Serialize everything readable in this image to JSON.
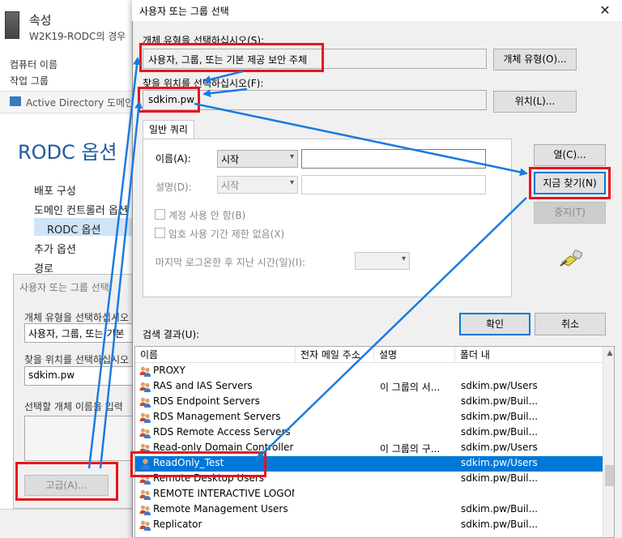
{
  "background_window": {
    "title": "속성",
    "subtitle": "W2K19-RODC의 경우",
    "computer_name_label": "컴퓨터 이름",
    "workgroup_label": "작업 그룹",
    "ad_bar_text": "Active Directory 도메인",
    "rodc_title": "RODC 옵션",
    "nav_items": [
      "배포 구성",
      "도메인 컨트롤러 옵션",
      "RODC 옵션",
      "추가 옵션",
      "경로"
    ],
    "inner_dialog": {
      "title": "사용자 또는 그룹 선택",
      "object_type_label": "개체 유형을 선택하십시오",
      "object_type_value": "사용자, 그룹, 또는 기본",
      "location_label": "찾을 위치를 선택하십시오",
      "location_value": "sdkim.pw",
      "enter_names_label": "선택할 개체 이름을 입력",
      "advanced_button": "고급(A)..."
    }
  },
  "dialog": {
    "title": "사용자 또는 그룹 선택",
    "object_type_label": "개체 유형을 선택하십시오(S):",
    "object_type_value": "사용자, 그룹, 또는 기본 제공 보안 주체",
    "object_types_button": "개체 유형(O)...",
    "location_label": "찾을 위치를 선택하십시오(F):",
    "location_value": "sdkim.pw",
    "locations_button": "위치(L)...",
    "tab_common_queries": "일반 쿼리",
    "name_label": "이름(A):",
    "name_combo_value": "시작",
    "description_label": "설명(D):",
    "description_combo_value": "시작",
    "disabled_accounts_label": "계정 사용 안 함(B)",
    "non_expiring_label": "암호 사용 기간 제한 없음(X)",
    "days_since_logon_label": "마지막 로그온한 후 지난 시간(일)(I):",
    "columns_button": "열(C)...",
    "find_now_button": "지금 찾기(N)",
    "stop_button": "중지(T)",
    "ok_button": "확인",
    "cancel_button": "취소",
    "results_label": "검색 결과(U):",
    "columns": [
      "이름",
      "전자 메일 주소",
      "설명",
      "폴더 내"
    ],
    "rows": [
      {
        "name": "PROXY",
        "email": "",
        "description": "",
        "folder": "",
        "icon": "group-icon"
      },
      {
        "name": "RAS and IAS Servers",
        "email": "",
        "description": "이 그룹의 서...",
        "folder": "sdkim.pw/Users",
        "icon": "group-icon"
      },
      {
        "name": "RDS Endpoint Servers",
        "email": "",
        "description": "",
        "folder": "sdkim.pw/Buil...",
        "icon": "group-icon"
      },
      {
        "name": "RDS Management Servers",
        "email": "",
        "description": "",
        "folder": "sdkim.pw/Buil...",
        "icon": "group-icon"
      },
      {
        "name": "RDS Remote Access Servers",
        "email": "",
        "description": "",
        "folder": "sdkim.pw/Buil...",
        "icon": "group-icon"
      },
      {
        "name": "Read-only Domain Controllers",
        "email": "",
        "description": "이 그룹의 구...",
        "folder": "sdkim.pw/Users",
        "icon": "group-icon"
      },
      {
        "name": "ReadOnly_Test",
        "email": "",
        "description": "",
        "folder": "sdkim.pw/Users",
        "icon": "user-icon",
        "selected": true
      },
      {
        "name": "Remote Desktop Users",
        "email": "",
        "description": "",
        "folder": "sdkim.pw/Buil...",
        "icon": "group-icon"
      },
      {
        "name": "REMOTE INTERACTIVE LOGON",
        "email": "",
        "description": "",
        "folder": "",
        "icon": "group-icon"
      },
      {
        "name": "Remote Management Users",
        "email": "",
        "description": "",
        "folder": "sdkim.pw/Buil...",
        "icon": "group-icon"
      },
      {
        "name": "Replicator",
        "email": "",
        "description": "",
        "folder": "sdkim.pw/Buil...",
        "icon": "group-icon"
      }
    ]
  },
  "colors": {
    "annotation_red": "#e8141b",
    "annotation_arrow": "#1a7be0",
    "selection_blue": "#0078d7"
  }
}
